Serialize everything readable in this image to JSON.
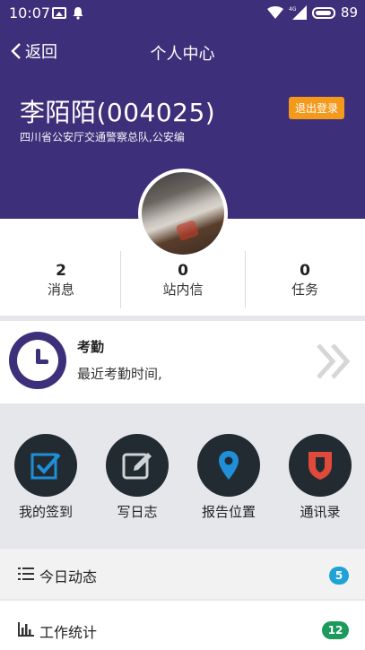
{
  "status_bar": {
    "time": "10:07",
    "network": "4G",
    "battery": "89",
    "icons": [
      "image-icon",
      "notification-bell-icon",
      "wifi-icon",
      "signal-icon",
      "battery-icon"
    ]
  },
  "header": {
    "back_label": "返回",
    "title": "个人中心",
    "user_name": "李陌陌(004025)",
    "unit": "四川省公安厅交通警察总队,公安编",
    "logout_label": "退出登录"
  },
  "stats": [
    {
      "count": "2",
      "label": "消息"
    },
    {
      "count": "0",
      "label": "站内信"
    },
    {
      "count": "0",
      "label": "任务"
    }
  ],
  "attendance": {
    "title": "考勤",
    "subtitle": "最近考勤时间,"
  },
  "actions": [
    {
      "label": "我的签到",
      "icon": "checkin-icon"
    },
    {
      "label": "写日志",
      "icon": "edit-log-icon"
    },
    {
      "label": "报告位置",
      "icon": "location-pin-icon"
    },
    {
      "label": "通讯录",
      "icon": "contacts-shield-icon"
    }
  ],
  "list": [
    {
      "label": "今日动态",
      "badge": "5",
      "badge_color": "#1fa3d6",
      "icon": "list-icon"
    },
    {
      "label": "工作统计",
      "badge": "12",
      "badge_color": "#1b9a5c",
      "icon": "bar-chart-icon"
    }
  ],
  "colors": {
    "primary": "#3e2f7a",
    "accent": "#f39a1d",
    "icon_blue": "#1e8fd8",
    "icon_red": "#e04a3a"
  }
}
